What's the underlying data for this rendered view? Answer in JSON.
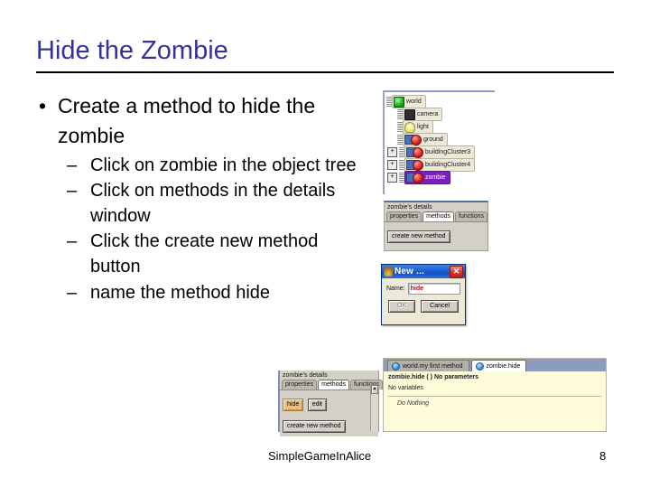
{
  "slide": {
    "title": "Hide the Zombie",
    "bullets": [
      {
        "level": 1,
        "marker": "•",
        "text": "Create a method to hide the zombie"
      },
      {
        "level": 2,
        "marker": "–",
        "text": "Click on zombie in the object tree"
      },
      {
        "level": 2,
        "marker": "–",
        "text": "Click on methods in the details window"
      },
      {
        "level": 2,
        "marker": "–",
        "text": "Click the create new method button"
      },
      {
        "level": 2,
        "marker": "–",
        "text": "name the method hide"
      }
    ]
  },
  "object_tree": {
    "nodes": [
      {
        "label": "world",
        "icon": "world-sphere-icon",
        "expander": "",
        "selected": false
      },
      {
        "label": "camera",
        "icon": "camera-icon",
        "expander": "",
        "selected": false
      },
      {
        "label": "light",
        "icon": "light-bulb-icon",
        "expander": "",
        "selected": false
      },
      {
        "label": "ground",
        "icon": "object-icon",
        "expander": "",
        "selected": false
      },
      {
        "label": "buildingCluster3",
        "icon": "object-icon",
        "expander": "+",
        "selected": false
      },
      {
        "label": "buildingCluster4",
        "icon": "object-icon",
        "expander": "+",
        "selected": false
      },
      {
        "label": "zombie",
        "icon": "object-icon",
        "expander": "+",
        "selected": true
      }
    ]
  },
  "details_panel": {
    "title": "zombie's details",
    "tabs": [
      {
        "label": "properties",
        "active": false
      },
      {
        "label": "methods",
        "active": true
      },
      {
        "label": "functions",
        "active": false
      }
    ],
    "create_button": "create new method"
  },
  "new_dialog": {
    "title": "New ...",
    "close_label": "✕",
    "name_label": "Name:",
    "name_value": "hide",
    "ok_label": "OK",
    "cancel_label": "Cancel"
  },
  "bottom_details_panel": {
    "title": "zombie's details",
    "tabs": [
      {
        "label": "properties",
        "active": false
      },
      {
        "label": "methods",
        "active": true
      },
      {
        "label": "functions",
        "active": false
      }
    ],
    "method_name": "hide",
    "edit_label": "edit",
    "create_button": "create new method",
    "scroll_up": "▲",
    "scroll_down": "▼"
  },
  "editor": {
    "tabs": [
      {
        "label": "world.my first method",
        "active": false
      },
      {
        "label": "zombie.hide",
        "active": true
      }
    ],
    "signature": "zombie.hide ( )  No parameters",
    "variables_line": "No variables",
    "body_line": "Do Nothing"
  },
  "footer": {
    "deck_title": "SimpleGameInAlice",
    "page_number": "8"
  },
  "colors": {
    "title": "#333399",
    "body_text": "#000000",
    "selection_purple": "#7a1fbd",
    "dialog_blue": "#1b5fd0",
    "close_red": "#d6322a",
    "editor_yellow": "#fdfbd8",
    "tab_strip_blue": "#8d9bbd",
    "method_tan": "#f0c07a"
  }
}
